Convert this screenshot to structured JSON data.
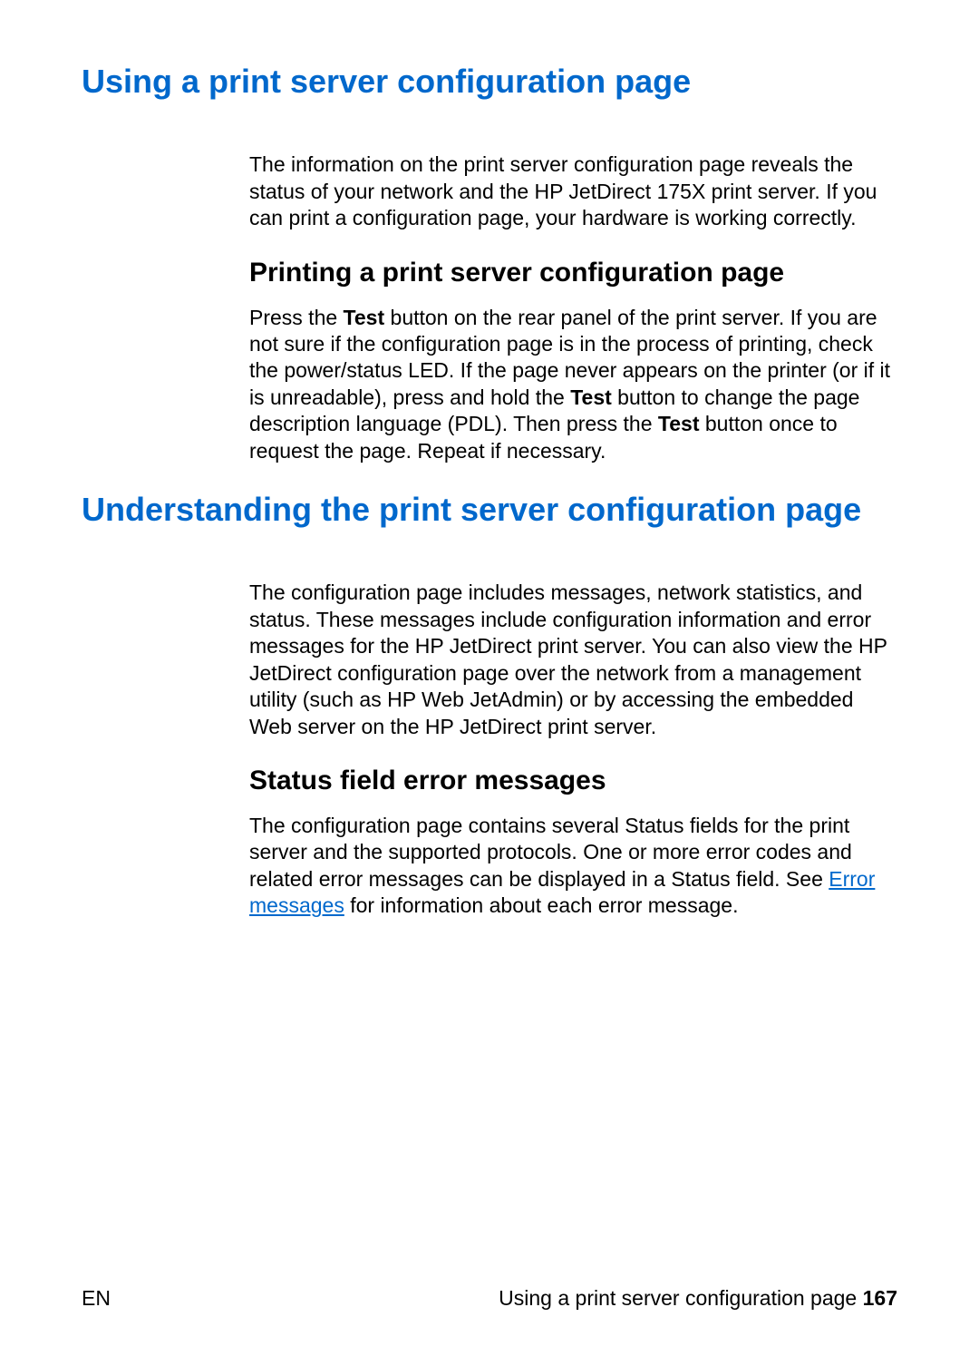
{
  "heading1": "Using a print server configuration page",
  "para1": "The information on the print server configuration page reveals the status of your network and the HP JetDirect 175X print server. If you can print a configuration page, your hardware is working correctly.",
  "subhead1": "Printing a print server configuration page",
  "para2_pre": "Press the ",
  "para2_bold1": "Test",
  "para2_mid1": " button on the rear panel of the print server. If you are not sure if the configuration page is in the process of printing, check the power/status LED. If the page never appears on the printer (or if it is unreadable), press and hold the ",
  "para2_bold2": "Test",
  "para2_mid2": " button to change the page description language (PDL). Then press the ",
  "para2_bold3": "Test",
  "para2_post": " button once to request the page. Repeat if necessary.",
  "heading2": "Understanding the print server configuration page",
  "para3": "The configuration page includes messages, network statistics, and status. These messages include configuration information and error messages for the HP JetDirect print server. You can also view the HP JetDirect configuration page over the network from a management utility (such as HP Web JetAdmin) or by accessing the embedded Web server on the HP JetDirect print server.",
  "subhead2": "Status field error messages",
  "para4_pre": "The configuration page contains several Status fields for the print server and the supported protocols. One or more error codes and related error messages can be displayed in a Status field. See ",
  "para4_link": "Error messages",
  "para4_post": " for information about each error message.",
  "footer_left": "EN",
  "footer_right_text": "Using a print server configuration page ",
  "footer_right_page": "167"
}
